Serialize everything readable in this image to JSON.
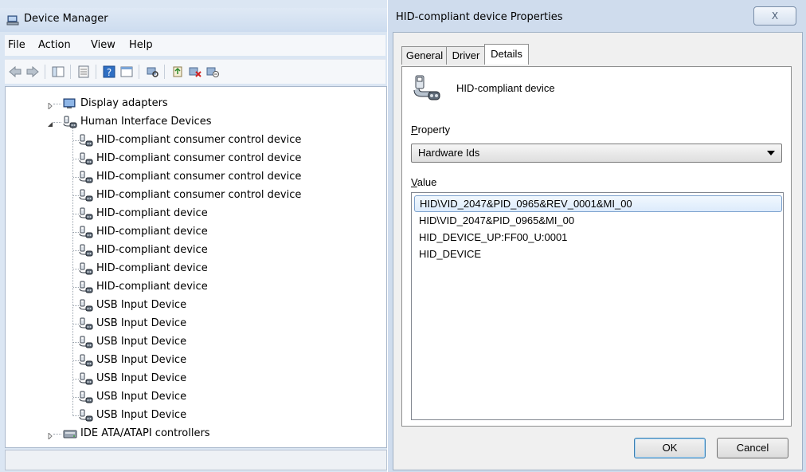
{
  "device_manager": {
    "title": "Device Manager",
    "menu": [
      "File",
      "Action",
      "View",
      "Help"
    ],
    "toolbar_icons": [
      "back-arrow-icon",
      "forward-arrow-icon",
      "show-hide-tree-icon",
      "properties-icon",
      "help-icon",
      "view-icon",
      "scan-hardware-icon",
      "update-driver-icon",
      "uninstall-icon",
      "disable-icon"
    ],
    "tree": [
      {
        "label": "Display adapters",
        "level": 1,
        "expanded": false,
        "icon": "display-adapter-icon"
      },
      {
        "label": "Human Interface Devices",
        "level": 1,
        "expanded": true,
        "icon": "hid-icon"
      },
      {
        "label": "HID-compliant consumer control device",
        "level": 2,
        "icon": "hid-icon"
      },
      {
        "label": "HID-compliant consumer control device",
        "level": 2,
        "icon": "hid-icon"
      },
      {
        "label": "HID-compliant consumer control device",
        "level": 2,
        "icon": "hid-icon"
      },
      {
        "label": "HID-compliant consumer control device",
        "level": 2,
        "icon": "hid-icon"
      },
      {
        "label": "HID-compliant device",
        "level": 2,
        "icon": "hid-icon"
      },
      {
        "label": "HID-compliant device",
        "level": 2,
        "icon": "hid-icon"
      },
      {
        "label": "HID-compliant device",
        "level": 2,
        "icon": "hid-icon"
      },
      {
        "label": "HID-compliant device",
        "level": 2,
        "icon": "hid-icon"
      },
      {
        "label": "HID-compliant device",
        "level": 2,
        "icon": "hid-icon"
      },
      {
        "label": "USB Input Device",
        "level": 2,
        "icon": "hid-icon"
      },
      {
        "label": "USB Input Device",
        "level": 2,
        "icon": "hid-icon"
      },
      {
        "label": "USB Input Device",
        "level": 2,
        "icon": "hid-icon"
      },
      {
        "label": "USB Input Device",
        "level": 2,
        "icon": "hid-icon"
      },
      {
        "label": "USB Input Device",
        "level": 2,
        "icon": "hid-icon"
      },
      {
        "label": "USB Input Device",
        "level": 2,
        "icon": "hid-icon"
      },
      {
        "label": "USB Input Device",
        "level": 2,
        "icon": "hid-icon"
      },
      {
        "label": "IDE ATA/ATAPI controllers",
        "level": 1,
        "expanded": false,
        "icon": "ide-controller-icon"
      }
    ],
    "status_text": ""
  },
  "properties": {
    "title": "HID-compliant device Properties",
    "close_label": "X",
    "tabs": [
      {
        "label": "General",
        "active": false
      },
      {
        "label": "Driver",
        "active": false
      },
      {
        "label": "Details",
        "active": true
      }
    ],
    "device_name": "HID-compliant device",
    "property_label": "Property",
    "property_value": "Hardware Ids",
    "value_label": "Value",
    "values": [
      {
        "text": "HID\\VID_2047&PID_0965&REV_0001&MI_00",
        "selected": true
      },
      {
        "text": "HID\\VID_2047&PID_0965&MI_00",
        "selected": false
      },
      {
        "text": "HID_DEVICE_UP:FF00_U:0001",
        "selected": false
      },
      {
        "text": "HID_DEVICE",
        "selected": false
      }
    ],
    "ok_label": "OK",
    "cancel_label": "Cancel"
  },
  "colors": {
    "window_frame": "#dbe6f3",
    "dialog_frame": "#cfdced",
    "selection_border": "#7da2ce"
  }
}
